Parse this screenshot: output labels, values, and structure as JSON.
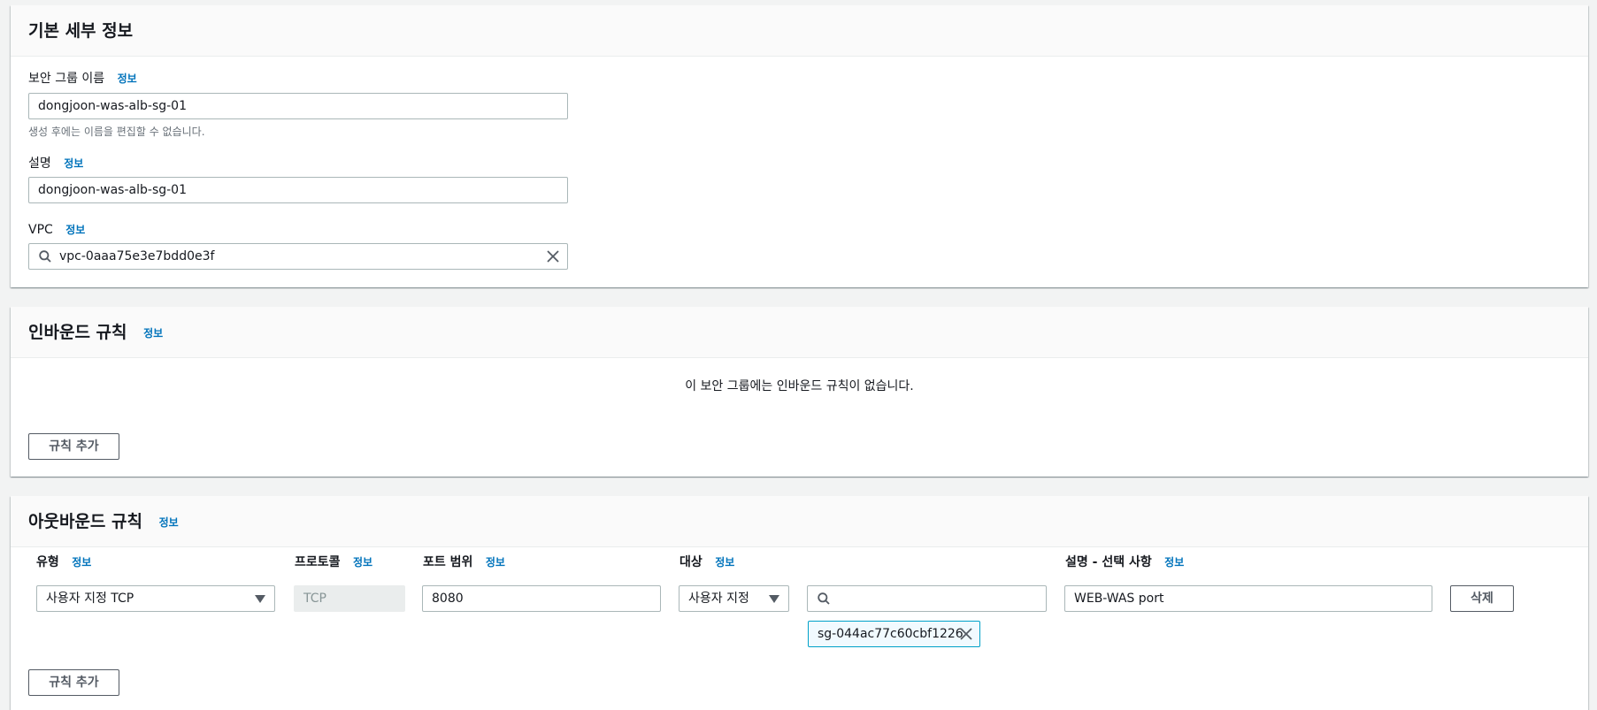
{
  "basic": {
    "title": "기본 세부 정보",
    "sg_name_label": "보안 그룹 이름",
    "sg_name_info": "정보",
    "sg_name_value": "dongjoon-was-alb-sg-01",
    "sg_name_hint": "생성 후에는 이름을 편집할 수 없습니다.",
    "desc_label": "설명",
    "desc_info": "정보",
    "desc_value": "dongjoon-was-alb-sg-01",
    "vpc_label": "VPC",
    "vpc_info": "정보",
    "vpc_value": "vpc-0aaa75e3e7bdd0e3f"
  },
  "inbound": {
    "title": "인바운드 규칙",
    "info": "정보",
    "empty_text": "이 보안 그룹에는 인바운드 규칙이 없습니다.",
    "add_rule": "규칙 추가"
  },
  "outbound": {
    "title": "아웃바운드 규칙",
    "info": "정보",
    "columns": {
      "type": "유형",
      "protocol": "프로토콜",
      "port_range": "포트 범위",
      "destination": "대상",
      "description": "설명 - 선택 사항",
      "info": "정보"
    },
    "rule": {
      "type": "사용자 지정 TCP",
      "protocol": "TCP",
      "port": "8080",
      "destination_type": "사용자 지정",
      "destination_search": "",
      "destination_token": "sg-044ac77c60cbf1226",
      "description": "WEB-WAS port",
      "delete": "삭제"
    },
    "add_rule": "규칙 추가"
  },
  "colors": {
    "link": "#0073bb",
    "token_border": "#00a1c9",
    "border": "#aab7b8"
  }
}
